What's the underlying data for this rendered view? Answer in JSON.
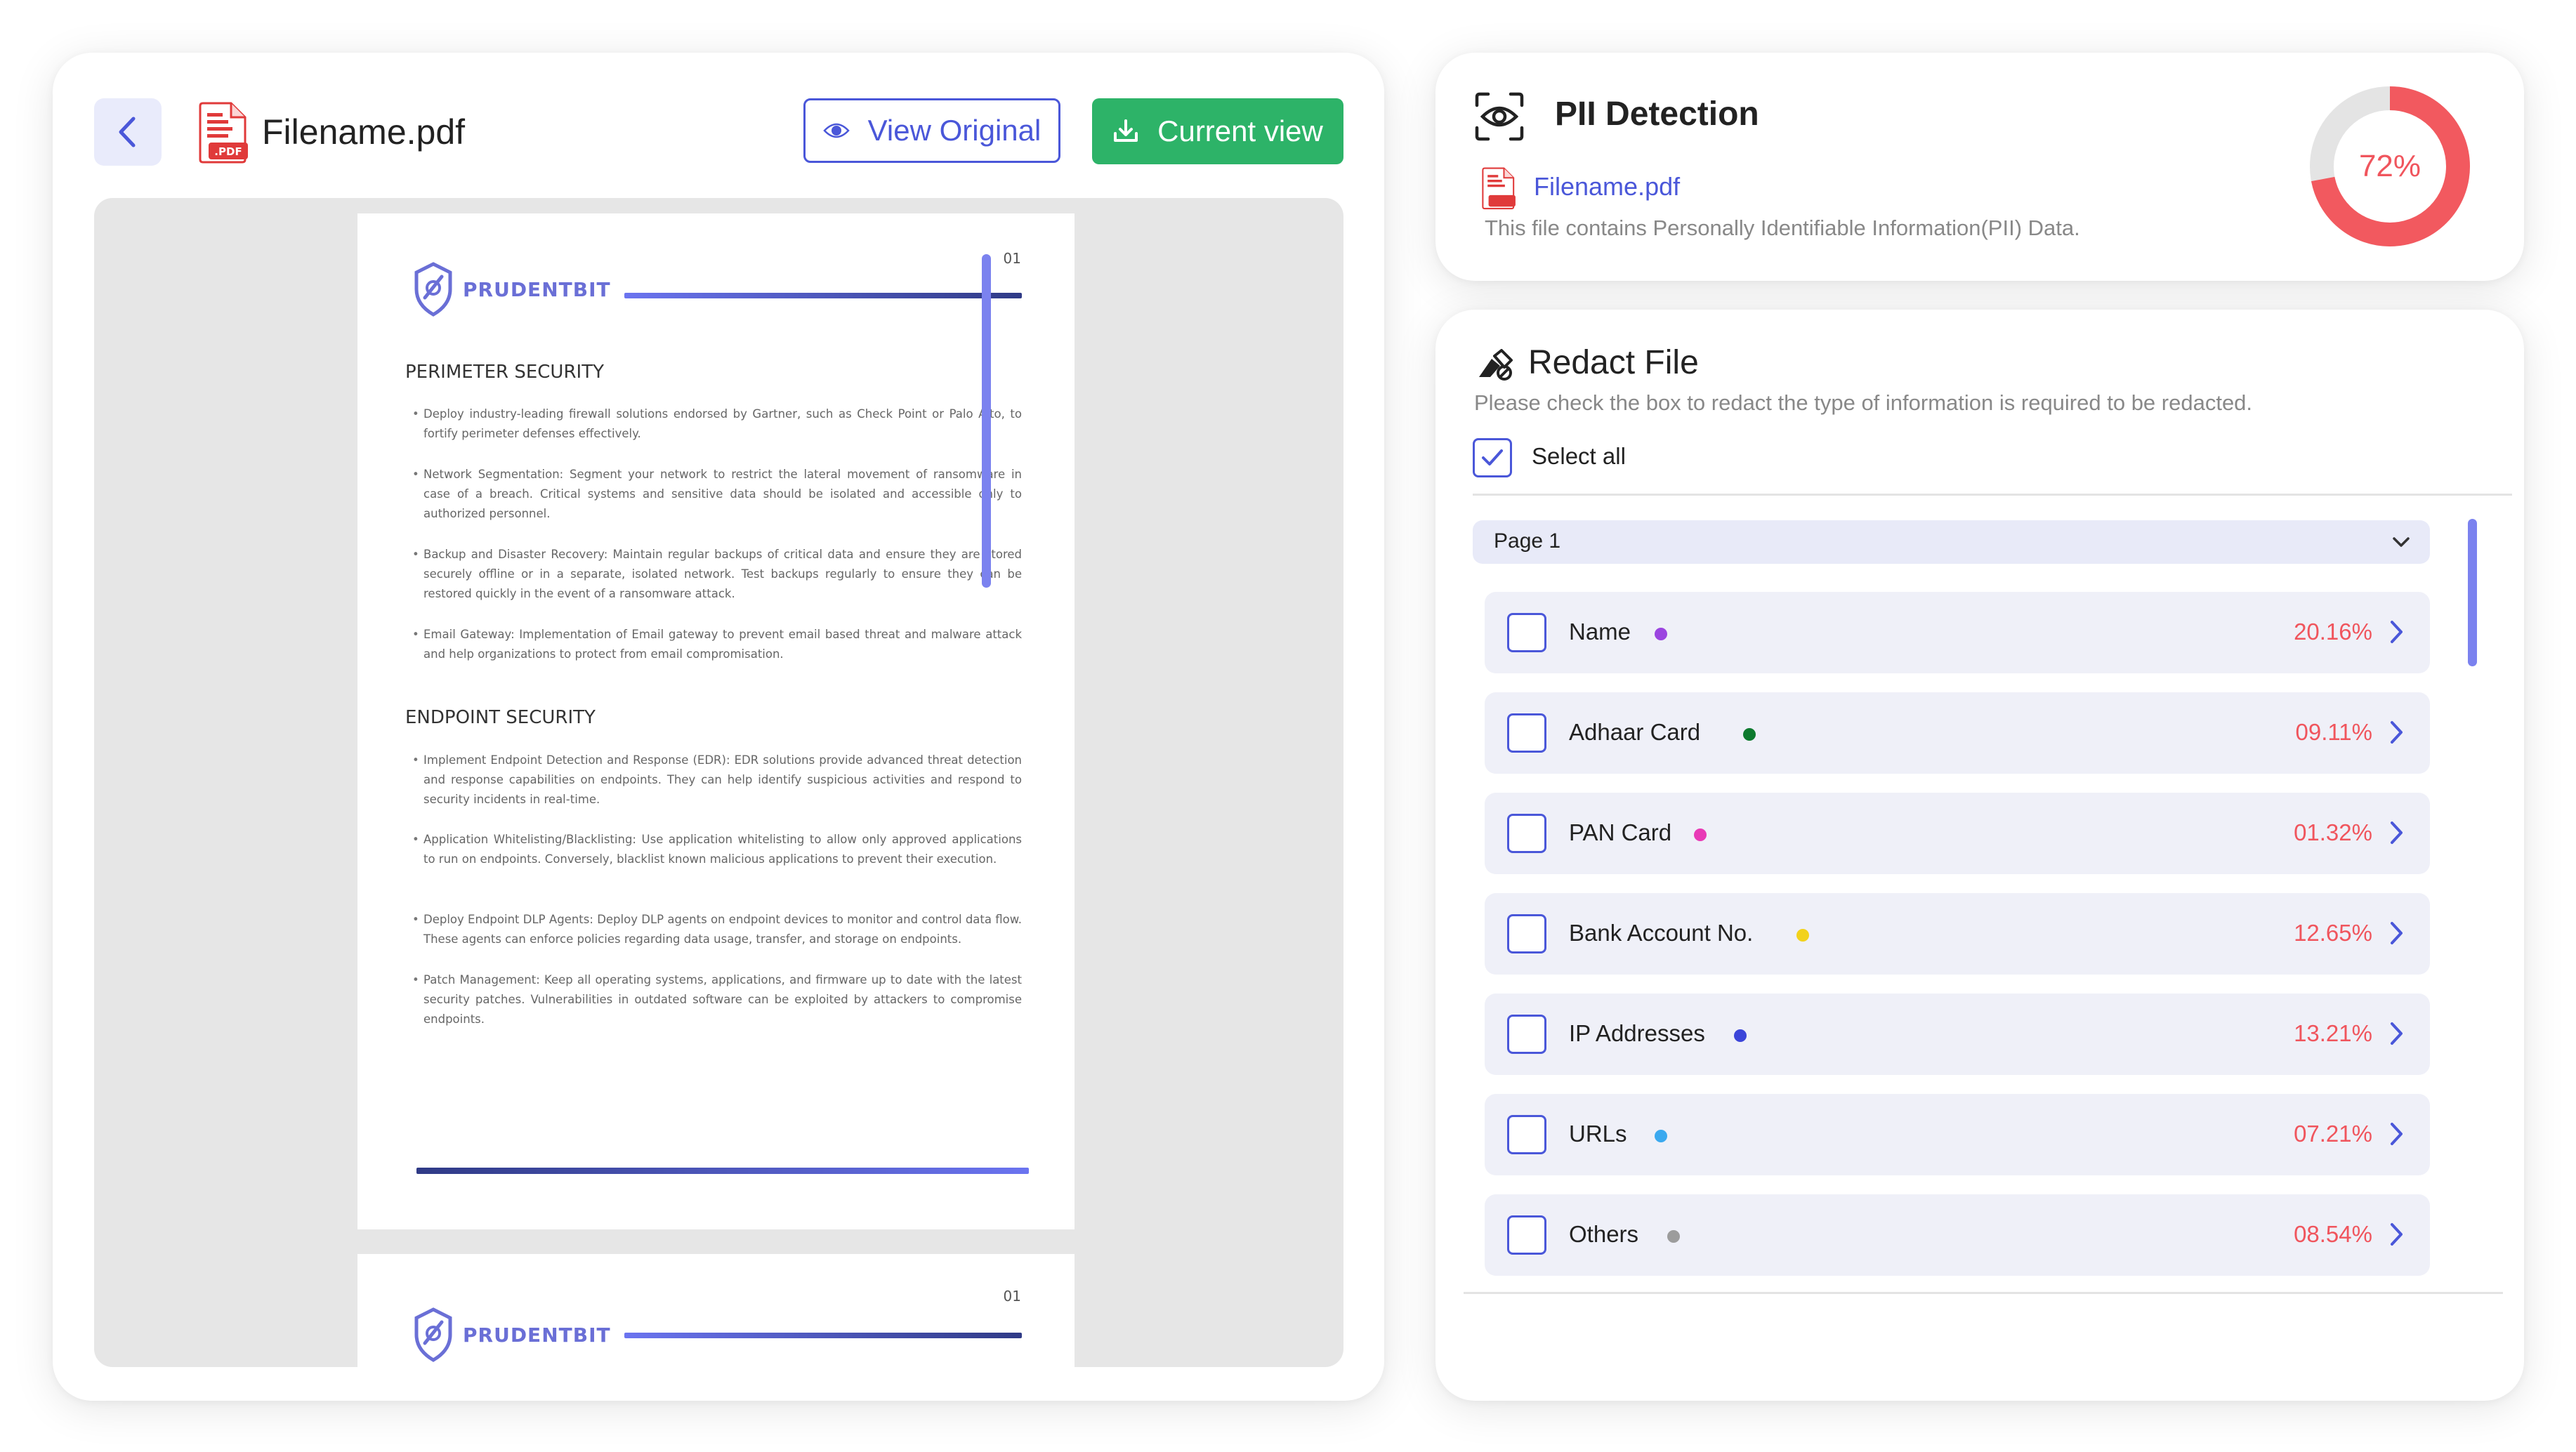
{
  "viewer": {
    "filename": "Filename.pdf",
    "view_original_label": "View Original",
    "current_view_label": "Current view"
  },
  "document": {
    "page_number": "01",
    "brand": "PRUDENTBIT",
    "section1_title": "PERIMETER SECURITY",
    "section1_bullets": [
      "Deploy industry-leading firewall solutions endorsed by Gartner, such as Check Point or Palo Alto, to fortify perimeter defenses effectively.",
      "Network Segmentation: Segment your network to restrict the lateral movement of ransomware in case of a breach. Critical systems and sensitive data should be isolated and accessible only to authorized personnel.",
      "Backup and Disaster Recovery: Maintain regular backups of critical data and ensure they are stored securely offline or in a separate, isolated network. Test backups regularly to ensure they can be restored quickly in the event of a ransomware attack.",
      "Email Gateway: Implementation of Email gateway to prevent email based threat and malware attack and help organizations to protect from email compromisation."
    ],
    "section2_title": "ENDPOINT SECURITY",
    "section2_bullets": [
      "Implement Endpoint Detection and Response (EDR): EDR solutions provide advanced threat detection and response capabilities on endpoints. They can help identify suspicious activities and respond to security incidents in real-time.",
      "Application Whitelisting/Blacklisting: Use application whitelisting to allow only approved applications to run on endpoints. Conversely, blacklist known malicious applications to prevent their execution.",
      "Deploy Endpoint DLP Agents: Deploy DLP agents on endpoint devices to monitor and control data flow. These agents can enforce policies regarding data usage, transfer, and storage on endpoints.",
      "Patch Management: Keep all operating systems, applications, and firmware up to date with the latest security patches. Vulnerabilities in outdated software can be exploited by attackers to compromise endpoints."
    ],
    "page2_number": "01",
    "page2_brand": "PRUDENTBIT"
  },
  "pii": {
    "title": "PII Detection",
    "filename": "Filename.pdf",
    "description": "This file contains Personally Identifiable Information(PII) Data.",
    "percent_label": "72%",
    "percent_value": 72,
    "ring_color": "#f2595f",
    "track_color": "#e4e4e4"
  },
  "redact": {
    "title": "Redact File",
    "description": "Please check the box to redact the type of information is required to be redacted.",
    "select_all_label": "Select all",
    "select_all_checked": true,
    "page_selector": "Page 1",
    "items": [
      {
        "label": "Name",
        "dot_color": "#9b45e0",
        "percent": "20.16%"
      },
      {
        "label": "Adhaar Card",
        "dot_color": "#0d7a2e",
        "percent": "09.11%"
      },
      {
        "label": "PAN Card",
        "dot_color": "#e83ab6",
        "percent": "01.32%"
      },
      {
        "label": "Bank Account No.",
        "dot_color": "#f2d21b",
        "percent": "12.65%"
      },
      {
        "label": "IP Addresses",
        "dot_color": "#3b45d9",
        "percent": "13.21%"
      },
      {
        "label": "URLs",
        "dot_color": "#3ba9ef",
        "percent": "07.21%"
      },
      {
        "label": "Others",
        "dot_color": "#9c9c9c",
        "percent": "08.54%"
      }
    ]
  }
}
